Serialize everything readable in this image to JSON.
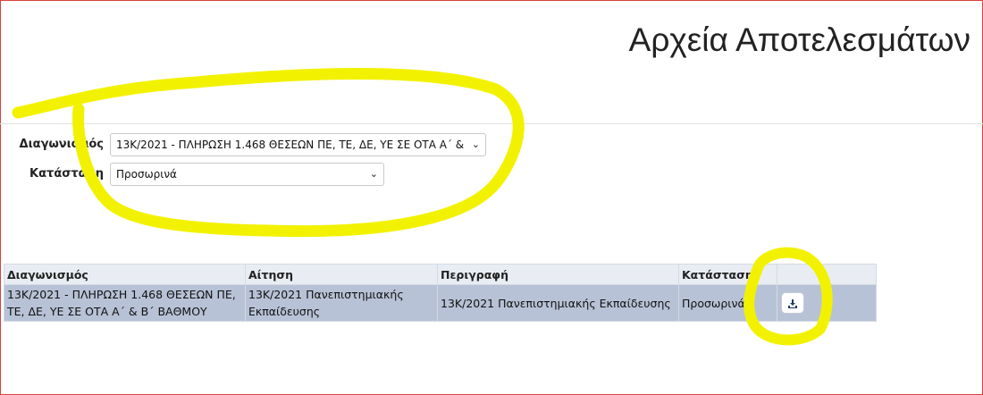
{
  "page": {
    "title": "Αρχεία Αποτελεσμάτων"
  },
  "filters": {
    "competition": {
      "label": "Διαγωνισμός",
      "value": "13Κ/2021 - ΠΛΗΡΩΣΗ 1.468 ΘΕΣΕΩΝ ΠΕ, ΤΕ, ΔΕ, ΥΕ ΣΕ ΟΤΑ Α΄ &"
    },
    "status": {
      "label": "Κατάσταση",
      "value": "Προσωρινά"
    }
  },
  "table": {
    "headers": [
      "Διαγωνισμός",
      "Αίτηση",
      "Περιγραφή",
      "Κατάσταση",
      ""
    ],
    "rows": [
      {
        "competition": "13Κ/2021 - ΠΛΗΡΩΣΗ 1.468 ΘΕΣΕΩΝ ΠΕ, ΤΕ, ΔΕ, ΥΕ ΣΕ ΟΤΑ Α΄ & Β΄ ΒΑΘΜΟΥ",
        "application": "13Κ/2021 Πανεπιστημιακής Εκπαίδευσης",
        "description": "13Κ/2021 Πανεπιστημιακής Εκπαίδευσης",
        "status": "Προσωρινά",
        "action_icon": "download-icon"
      }
    ]
  },
  "colors": {
    "highlight": "#f2f200",
    "row_bg": "#b7c2d6",
    "header_bg": "#e9edf3",
    "frame": "#d9413b"
  }
}
